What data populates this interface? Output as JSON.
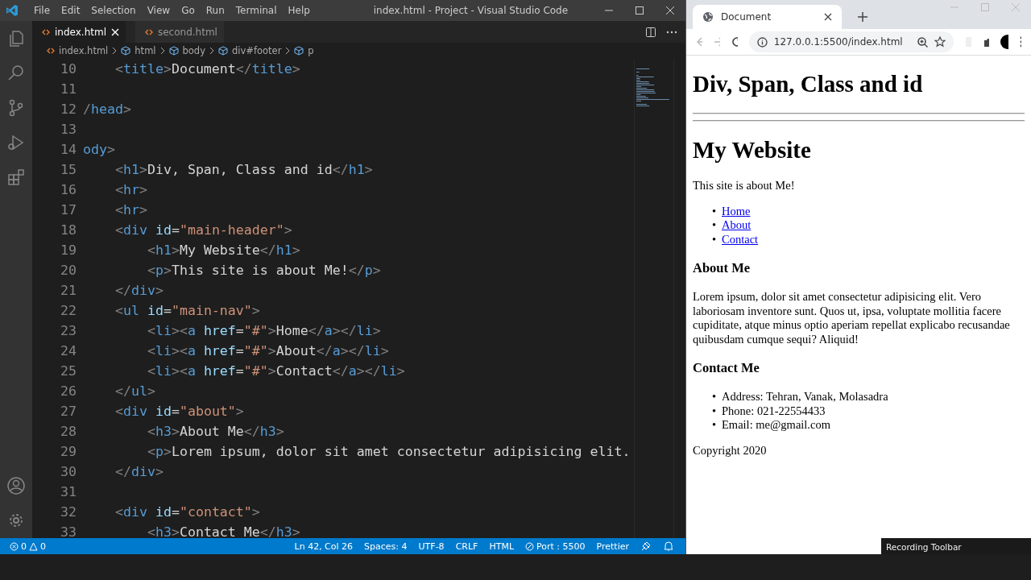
{
  "vscode": {
    "menu": [
      "File",
      "Edit",
      "Selection",
      "View",
      "Go",
      "Run",
      "Terminal",
      "Help"
    ],
    "title": "index.html - Project - Visual Studio Code",
    "tabs": [
      {
        "label": "index.html",
        "selected": true
      },
      {
        "label": "second.html",
        "selected": false
      }
    ],
    "breadcrumbs": [
      {
        "label": "index.html",
        "kind": "file"
      },
      {
        "label": "html",
        "kind": "element"
      },
      {
        "label": "body",
        "kind": "element"
      },
      {
        "label": "div#footer",
        "kind": "element"
      },
      {
        "label": "p",
        "kind": "element"
      }
    ],
    "code_lines": [
      {
        "number": "10",
        "tokens": [
          {
            "text": "    <",
            "kind": "punct"
          },
          {
            "text": "title",
            "kind": "tag"
          },
          {
            "text": ">",
            "kind": "punct"
          },
          {
            "text": "Document",
            "kind": "text"
          },
          {
            "text": "</",
            "kind": "punct"
          },
          {
            "text": "title",
            "kind": "tag"
          },
          {
            "text": ">",
            "kind": "punct"
          }
        ]
      },
      {
        "number": "11"
      },
      {
        "number": "12",
        "tokens": [
          {
            "text": "/",
            "kind": "punct"
          },
          {
            "text": "head",
            "kind": "tag"
          },
          {
            "text": ">",
            "kind": "punct"
          }
        ]
      },
      {
        "number": "13"
      },
      {
        "number": "14",
        "tokens": [
          {
            "text": "ody",
            "kind": "tag"
          },
          {
            "text": ">",
            "kind": "punct"
          }
        ]
      },
      {
        "number": "15",
        "tokens": [
          {
            "text": "    <",
            "kind": "punct"
          },
          {
            "text": "h1",
            "kind": "tag"
          },
          {
            "text": ">",
            "kind": "punct"
          },
          {
            "text": "Div, Span, Class and id",
            "kind": "text"
          },
          {
            "text": "</",
            "kind": "punct"
          },
          {
            "text": "h1",
            "kind": "tag"
          },
          {
            "text": ">",
            "kind": "punct"
          }
        ]
      },
      {
        "number": "16",
        "tokens": [
          {
            "text": "    <",
            "kind": "punct"
          },
          {
            "text": "hr",
            "kind": "tag"
          },
          {
            "text": ">",
            "kind": "punct"
          }
        ]
      },
      {
        "number": "17",
        "tokens": [
          {
            "text": "    <",
            "kind": "punct"
          },
          {
            "text": "hr",
            "kind": "tag"
          },
          {
            "text": ">",
            "kind": "punct"
          }
        ]
      },
      {
        "number": "18",
        "tokens": [
          {
            "text": "    <",
            "kind": "punct"
          },
          {
            "text": "div",
            "kind": "tag"
          },
          {
            "text": " id",
            "kind": "attr"
          },
          {
            "text": "=",
            "kind": "text"
          },
          {
            "text": "\"main-header\"",
            "kind": "string"
          },
          {
            "text": ">",
            "kind": "punct"
          }
        ]
      },
      {
        "number": "19",
        "tokens": [
          {
            "text": "        <",
            "kind": "punct"
          },
          {
            "text": "h1",
            "kind": "tag"
          },
          {
            "text": ">",
            "kind": "punct"
          },
          {
            "text": "My Website",
            "kind": "text"
          },
          {
            "text": "</",
            "kind": "punct"
          },
          {
            "text": "h1",
            "kind": "tag"
          },
          {
            "text": ">",
            "kind": "punct"
          }
        ]
      },
      {
        "number": "20",
        "tokens": [
          {
            "text": "        <",
            "kind": "punct"
          },
          {
            "text": "p",
            "kind": "tag"
          },
          {
            "text": ">",
            "kind": "punct"
          },
          {
            "text": "This site is about Me!",
            "kind": "text"
          },
          {
            "text": "</",
            "kind": "punct"
          },
          {
            "text": "p",
            "kind": "tag"
          },
          {
            "text": ">",
            "kind": "punct"
          }
        ]
      },
      {
        "number": "21",
        "tokens": [
          {
            "text": "    </",
            "kind": "punct"
          },
          {
            "text": "div",
            "kind": "tag"
          },
          {
            "text": ">",
            "kind": "punct"
          }
        ]
      },
      {
        "number": "22",
        "tokens": [
          {
            "text": "    <",
            "kind": "punct"
          },
          {
            "text": "ul",
            "kind": "tag"
          },
          {
            "text": " id",
            "kind": "attr"
          },
          {
            "text": "=",
            "kind": "text"
          },
          {
            "text": "\"main-nav\"",
            "kind": "string"
          },
          {
            "text": ">",
            "kind": "punct"
          }
        ]
      },
      {
        "number": "23",
        "tokens": [
          {
            "text": "        <",
            "kind": "punct"
          },
          {
            "text": "li",
            "kind": "tag"
          },
          {
            "text": "><",
            "kind": "punct"
          },
          {
            "text": "a",
            "kind": "tag"
          },
          {
            "text": " href",
            "kind": "attr"
          },
          {
            "text": "=",
            "kind": "text"
          },
          {
            "text": "\"#\"",
            "kind": "string"
          },
          {
            "text": ">",
            "kind": "punct"
          },
          {
            "text": "Home",
            "kind": "text"
          },
          {
            "text": "</",
            "kind": "punct"
          },
          {
            "text": "a",
            "kind": "tag"
          },
          {
            "text": "></",
            "kind": "punct"
          },
          {
            "text": "li",
            "kind": "tag"
          },
          {
            "text": ">",
            "kind": "punct"
          }
        ]
      },
      {
        "number": "24",
        "tokens": [
          {
            "text": "        <",
            "kind": "punct"
          },
          {
            "text": "li",
            "kind": "tag"
          },
          {
            "text": "><",
            "kind": "punct"
          },
          {
            "text": "a",
            "kind": "tag"
          },
          {
            "text": " href",
            "kind": "attr"
          },
          {
            "text": "=",
            "kind": "text"
          },
          {
            "text": "\"#\"",
            "kind": "string"
          },
          {
            "text": ">",
            "kind": "punct"
          },
          {
            "text": "About",
            "kind": "text"
          },
          {
            "text": "</",
            "kind": "punct"
          },
          {
            "text": "a",
            "kind": "tag"
          },
          {
            "text": "></",
            "kind": "punct"
          },
          {
            "text": "li",
            "kind": "tag"
          },
          {
            "text": ">",
            "kind": "punct"
          }
        ]
      },
      {
        "number": "25",
        "tokens": [
          {
            "text": "        <",
            "kind": "punct"
          },
          {
            "text": "li",
            "kind": "tag"
          },
          {
            "text": "><",
            "kind": "punct"
          },
          {
            "text": "a",
            "kind": "tag"
          },
          {
            "text": " href",
            "kind": "attr"
          },
          {
            "text": "=",
            "kind": "text"
          },
          {
            "text": "\"#\"",
            "kind": "string"
          },
          {
            "text": ">",
            "kind": "punct"
          },
          {
            "text": "Contact",
            "kind": "text"
          },
          {
            "text": "</",
            "kind": "punct"
          },
          {
            "text": "a",
            "kind": "tag"
          },
          {
            "text": "></",
            "kind": "punct"
          },
          {
            "text": "li",
            "kind": "tag"
          },
          {
            "text": ">",
            "kind": "punct"
          }
        ]
      },
      {
        "number": "26",
        "tokens": [
          {
            "text": "    </",
            "kind": "punct"
          },
          {
            "text": "ul",
            "kind": "tag"
          },
          {
            "text": ">",
            "kind": "punct"
          }
        ]
      },
      {
        "number": "27",
        "tokens": [
          {
            "text": "    <",
            "kind": "punct"
          },
          {
            "text": "div",
            "kind": "tag"
          },
          {
            "text": " id",
            "kind": "attr"
          },
          {
            "text": "=",
            "kind": "text"
          },
          {
            "text": "\"about\"",
            "kind": "string"
          },
          {
            "text": ">",
            "kind": "punct"
          }
        ]
      },
      {
        "number": "28",
        "tokens": [
          {
            "text": "        <",
            "kind": "punct"
          },
          {
            "text": "h3",
            "kind": "tag"
          },
          {
            "text": ">",
            "kind": "punct"
          },
          {
            "text": "About Me",
            "kind": "text"
          },
          {
            "text": "</",
            "kind": "punct"
          },
          {
            "text": "h3",
            "kind": "tag"
          },
          {
            "text": ">",
            "kind": "punct"
          }
        ]
      },
      {
        "number": "29",
        "tokens": [
          {
            "text": "        <",
            "kind": "punct"
          },
          {
            "text": "p",
            "kind": "tag"
          },
          {
            "text": ">",
            "kind": "punct"
          },
          {
            "text": "Lorem ipsum, dolor sit amet consectetur adipisicing elit.",
            "kind": "text"
          }
        ]
      },
      {
        "number": "30",
        "tokens": [
          {
            "text": "    </",
            "kind": "punct"
          },
          {
            "text": "div",
            "kind": "tag"
          },
          {
            "text": ">",
            "kind": "punct"
          }
        ]
      },
      {
        "number": "31"
      },
      {
        "number": "32",
        "tokens": [
          {
            "text": "    <",
            "kind": "punct"
          },
          {
            "text": "div",
            "kind": "tag"
          },
          {
            "text": " id",
            "kind": "attr"
          },
          {
            "text": "=",
            "kind": "text"
          },
          {
            "text": "\"contact\"",
            "kind": "string"
          },
          {
            "text": ">",
            "kind": "punct"
          }
        ]
      },
      {
        "number": "33",
        "tokens": [
          {
            "text": "        <",
            "kind": "punct"
          },
          {
            "text": "h3",
            "kind": "tag"
          },
          {
            "text": ">",
            "kind": "punct"
          },
          {
            "text": "Contact Me",
            "kind": "text"
          },
          {
            "text": "</",
            "kind": "punct"
          },
          {
            "text": "h3",
            "kind": "tag"
          },
          {
            "text": ">",
            "kind": "punct"
          }
        ]
      }
    ],
    "status_bar": {
      "errors": "0",
      "warnings": "0",
      "items": [
        {
          "text": "Ln 42, Col 26",
          "kind": "text"
        },
        {
          "text": "Spaces: 4",
          "kind": "text"
        },
        {
          "text": "UTF-8",
          "kind": "text"
        },
        {
          "text": "CRLF",
          "kind": "text"
        },
        {
          "text": "HTML",
          "kind": "text"
        },
        {
          "text": "Port : 5500",
          "kind": "port"
        },
        {
          "text": "Prettier",
          "kind": "text"
        }
      ]
    }
  },
  "browser": {
    "tab": {
      "title": "Document"
    },
    "url": "127.0.0.1:5500/index.html",
    "page": [
      {
        "kind": "h1",
        "text": "Div, Span, Class and id"
      },
      {
        "kind": "hr"
      },
      {
        "kind": "hr"
      },
      {
        "kind": "h1",
        "text": "My Website"
      },
      {
        "kind": "p",
        "text": "This site is about Me!"
      },
      {
        "kind": "links",
        "marker": "•",
        "items": [
          "Home",
          "About",
          "Contact"
        ]
      },
      {
        "kind": "h3",
        "text": "About Me"
      },
      {
        "kind": "p",
        "text": "Lorem ipsum, dolor sit amet consectetur adipisicing elit. Vero laboriosam inventore sunt. Quos ut, ipsa, voluptate mollitia facere cupiditate, atque minus optio aperiam repellat explicabo recusandae quibusdam cumque sequi? Aliquid!"
      },
      {
        "kind": "h3",
        "text": "Contact Me"
      },
      {
        "kind": "list",
        "marker": "•",
        "items": [
          "Address: Tehran, Vanak, Molasadra",
          "Phone: 021-22554433",
          "Email: me@gmail.com"
        ]
      },
      {
        "kind": "p",
        "text": "Copyright 2020"
      }
    ]
  },
  "tooltip": "Recording Toolbar"
}
